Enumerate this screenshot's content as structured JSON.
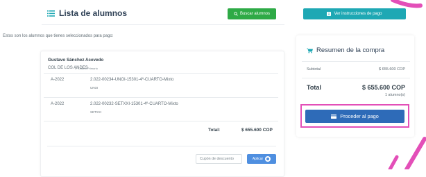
{
  "header": {
    "list_title": "Lista de alumnos",
    "buscar_label": "Buscar alumnos",
    "instrucciones_label": "Ver instrucciones de pago"
  },
  "intro_text": "Estos son los alumnos que tienes seleccionados para pago:",
  "student": {
    "name": "Gustavo Sánchez Acevedo",
    "school": "COL DE LOS ANDES",
    "grade": "4º Cuarto Primario",
    "items": [
      {
        "year": "A-2022",
        "code": "2.022-00234-UNOI-15301-4º-CUARTO-Mixto",
        "provider": "UNOI"
      },
      {
        "year": "A-2022",
        "code": "2.022-00232-SETXXI-15301-4º-CUARTO-Mixto",
        "provider": "SETXXI"
      }
    ],
    "total_label": "Total:",
    "total_value": "$ 655.600 COP"
  },
  "coupon": {
    "placeholder": "Cupón de descuento",
    "apply_label": "Aplicar"
  },
  "summary": {
    "title": "Resumen de la compra",
    "subtotal_label": "Subtotal",
    "subtotal_value": "$ 655.600 COP",
    "total_label": "Total",
    "total_value": "$ 655.600 COP",
    "alumnos_count": "1 alumno(s)",
    "pay_label": "Proceder al pago"
  },
  "colors": {
    "buscar": "#2eaa46",
    "instrucciones": "#1ea8b4",
    "pay_button": "#2e6bb8",
    "highlight": "#e34fb8",
    "cart_icon": "#1ea8b4"
  },
  "icons": [
    "list-icon",
    "search-icon",
    "info-icon",
    "cart-icon",
    "card-icon",
    "apply-icon"
  ]
}
